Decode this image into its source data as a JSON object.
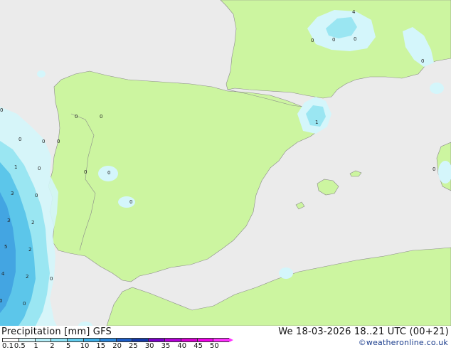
{
  "map": {
    "colors": {
      "sea": "#ebebeb",
      "land": "#ccf5a0",
      "border": "#8a8a8a",
      "precip_light": "#d4f6fb",
      "precip_mid": "#9ae6f2",
      "precip_strong": "#5cc6ea",
      "precip_heavy": "#3e9fe0"
    },
    "point_values": [
      {
        "id": "n1",
        "text": "4"
      },
      {
        "id": "n2",
        "text": "0"
      },
      {
        "id": "n3",
        "text": "0"
      },
      {
        "id": "n4",
        "text": "0"
      },
      {
        "id": "n5",
        "text": "0"
      },
      {
        "id": "n6",
        "text": "1"
      },
      {
        "id": "n7",
        "text": "0"
      },
      {
        "id": "n8",
        "text": "0"
      },
      {
        "id": "n9",
        "text": "0"
      },
      {
        "id": "n10",
        "text": "1"
      },
      {
        "id": "n11",
        "text": "0"
      },
      {
        "id": "n12",
        "text": "0"
      },
      {
        "id": "n13",
        "text": "0"
      },
      {
        "id": "n14",
        "text": "0"
      },
      {
        "id": "n15",
        "text": "0"
      },
      {
        "id": "n16",
        "text": "3"
      },
      {
        "id": "n17",
        "text": "0"
      },
      {
        "id": "n18",
        "text": "2"
      },
      {
        "id": "n19",
        "text": "3"
      },
      {
        "id": "n20",
        "text": "2"
      },
      {
        "id": "n21",
        "text": "5"
      },
      {
        "id": "n22",
        "text": "2"
      },
      {
        "id": "n23",
        "text": "4"
      },
      {
        "id": "n24",
        "text": "0"
      },
      {
        "id": "n25",
        "text": "0"
      },
      {
        "id": "n26",
        "text": "0"
      },
      {
        "id": "n27",
        "text": "0"
      },
      {
        "id": "n28",
        "text": "0"
      },
      {
        "id": "n29",
        "text": "0"
      }
    ]
  },
  "footer": {
    "title": "Precipitation [mm]  GFS",
    "datetime": "We 18-03-2026 18..21 UTC (00+21)",
    "credit": "©weatheronline.co.uk"
  },
  "legend": {
    "ticks": [
      "0.1",
      "0.5",
      "1",
      "2",
      "5",
      "10",
      "15",
      "20",
      "25",
      "30",
      "35",
      "40",
      "45",
      "50"
    ],
    "colors": [
      "#ffffff",
      "#d4f6fb",
      "#b4eef8",
      "#8ee2f4",
      "#62cdee",
      "#3eaee6",
      "#2a86da",
      "#1c5cc6",
      "#143aa8",
      "#7a00c8",
      "#b400d8",
      "#d600d0",
      "#f000e8",
      "#ff30ff"
    ]
  }
}
